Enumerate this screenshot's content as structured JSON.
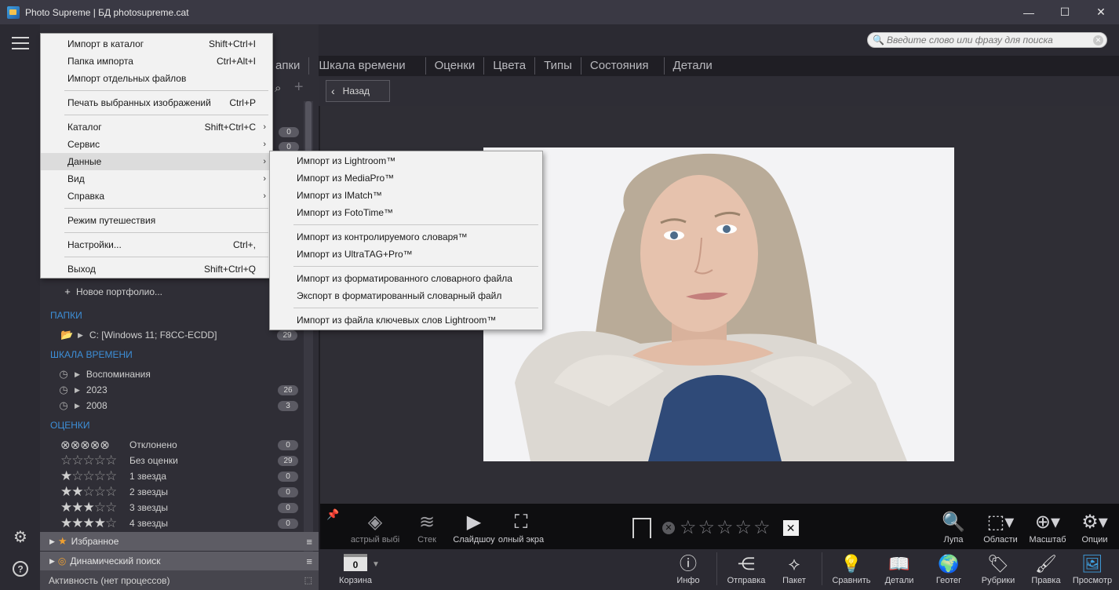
{
  "window": {
    "title": "Photo Supreme | БД photosupreme.cat",
    "minimize": "—",
    "maximize": "☐",
    "close": "✕"
  },
  "search": {
    "placeholder": "Введите слово или фразу для поиска"
  },
  "tabs": [
    "апки",
    "Шкала времени",
    "Оценки",
    "Цвета",
    "Типы",
    "Состояния",
    "Детали"
  ],
  "back_label": "Назад",
  "main_menu": {
    "items": [
      {
        "label": "Импорт в каталог",
        "shortcut": "Shift+Ctrl+I"
      },
      {
        "label": "Папка импорта",
        "shortcut": "Ctrl+Alt+I"
      },
      {
        "label": "Импорт отдельных файлов",
        "shortcut": ""
      },
      {
        "label": "Печать выбранных изображений",
        "shortcut": "Ctrl+P"
      },
      {
        "label": "Каталог",
        "shortcut": "Shift+Ctrl+C"
      },
      {
        "label": "Сервис",
        "shortcut": ""
      },
      {
        "label": "Данные",
        "shortcut": ""
      },
      {
        "label": "Вид",
        "shortcut": ""
      },
      {
        "label": "Справка",
        "shortcut": ""
      },
      {
        "label": "Режим путешествия",
        "shortcut": ""
      },
      {
        "label": "Настройки...",
        "shortcut": "Ctrl+,"
      },
      {
        "label": "Выход",
        "shortcut": "Shift+Ctrl+Q"
      }
    ]
  },
  "data_submenu": {
    "items": [
      "Импорт из Lightroom™",
      "Импорт из MediaPro™",
      "Импорт из IMatch™",
      "Импорт из FotoTime™",
      "Импорт из контролируемого словаря™",
      "Импорт из UltraTAG+Pro™",
      "Импорт из форматированного словарного файла",
      "Экспорт в форматированный словарный файл",
      "Импорт из файла ключевых слов Lightroom™"
    ]
  },
  "left_panel": {
    "hidden_badges": [
      "0",
      "0"
    ],
    "new_portfolio": "Новое портфолио...",
    "folders_title": "ПАПКИ",
    "folder": {
      "label": "C:  [Windows 11; F8CC-ECDD]",
      "count": "29"
    },
    "timeline_title": "ШКАЛА ВРЕМЕНИ",
    "timeline": [
      {
        "label": "Воспоминания",
        "count": ""
      },
      {
        "label": "2023",
        "count": "26"
      },
      {
        "label": "2008",
        "count": "3"
      }
    ],
    "ratings_title": "ОЦЕНКИ",
    "ratings": [
      {
        "label": "Отклонено",
        "count": "0"
      },
      {
        "label": "Без оценки",
        "count": "29"
      },
      {
        "label": "1 звезда",
        "count": "0"
      },
      {
        "label": "2 звезды",
        "count": "0"
      },
      {
        "label": "3 звезды",
        "count": "0"
      },
      {
        "label": "4 звезды",
        "count": "0"
      }
    ],
    "favorites": "Избранное",
    "dynamic_search": "Динамический поиск",
    "activity": "Активность (нет процессов)"
  },
  "viewer_tools": {
    "quick_select": "астрый выбі",
    "stack": "Стек",
    "slideshow": "Слайдшоу",
    "fullscreen": "олный экра",
    "loupe": "Лупа",
    "regions": "Области",
    "zoom": "Масштаб",
    "options": "Опции"
  },
  "bottom_tools": {
    "basket_label": "Корзина",
    "basket_count": "0",
    "info": "Инфо",
    "share": "Отправка",
    "batch": "Пакет",
    "compare": "Сравнить",
    "details": "Детали",
    "geotag": "Геотег",
    "categories": "Рубрики",
    "edit": "Правка",
    "view": "Просмотр"
  },
  "colors": {
    "accent": "#3d8fd8",
    "background": "#1f1e24",
    "menu_bg": "#f2f2f2"
  }
}
